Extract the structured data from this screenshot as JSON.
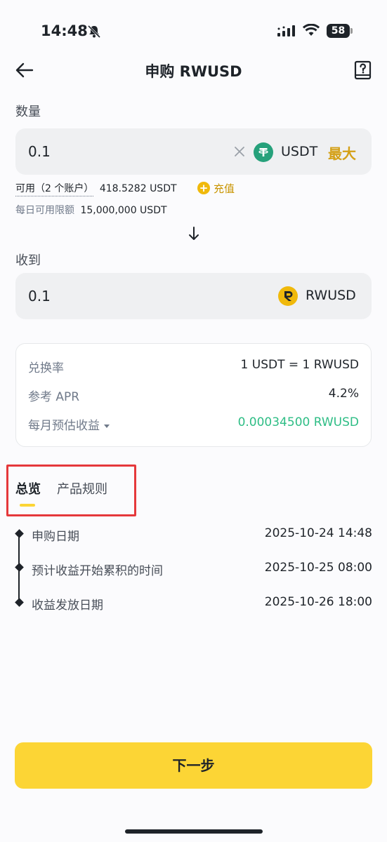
{
  "status_bar": {
    "time": "14:48",
    "battery": "58"
  },
  "header": {
    "title": "申购 RWUSD",
    "back_icon": "arrow-left-icon",
    "help_icon": "help-book-icon"
  },
  "amount": {
    "label": "数量",
    "value": "0.1",
    "currency": "USDT",
    "max_label": "最大",
    "currency_icon": "usdt-coin-icon"
  },
  "available": {
    "label": "可用（2 个账户）",
    "value": "418.5282 USDT",
    "topup_label": "充值",
    "daily_limit_label": "每日可用限额",
    "daily_limit_value": "15,000,000 USDT"
  },
  "receive": {
    "label": "收到",
    "value": "0.1",
    "currency": "RWUSD",
    "currency_icon": "rwusd-coin-icon"
  },
  "info": {
    "rate_label": "兑换率",
    "rate_value": "1 USDT = 1 RWUSD",
    "apr_label": "参考 APR",
    "apr_value": "4.2%",
    "monthly_label": "每月预估收益",
    "monthly_value": "0.00034500 RWUSD"
  },
  "tabs": [
    {
      "label": "总览",
      "active": true
    },
    {
      "label": "产品规则",
      "active": false
    }
  ],
  "timeline": [
    {
      "label": "申购日期",
      "value": "2025-10-24 14:48"
    },
    {
      "label": "预计收益开始累积的时间",
      "value": "2025-10-25 08:00"
    },
    {
      "label": "收益发放日期",
      "value": "2025-10-26 18:00"
    }
  ],
  "next_button": {
    "label": "下一步"
  },
  "colors": {
    "accent": "#fcd535",
    "green": "#2ebd85",
    "highlight": "#e5383b"
  }
}
